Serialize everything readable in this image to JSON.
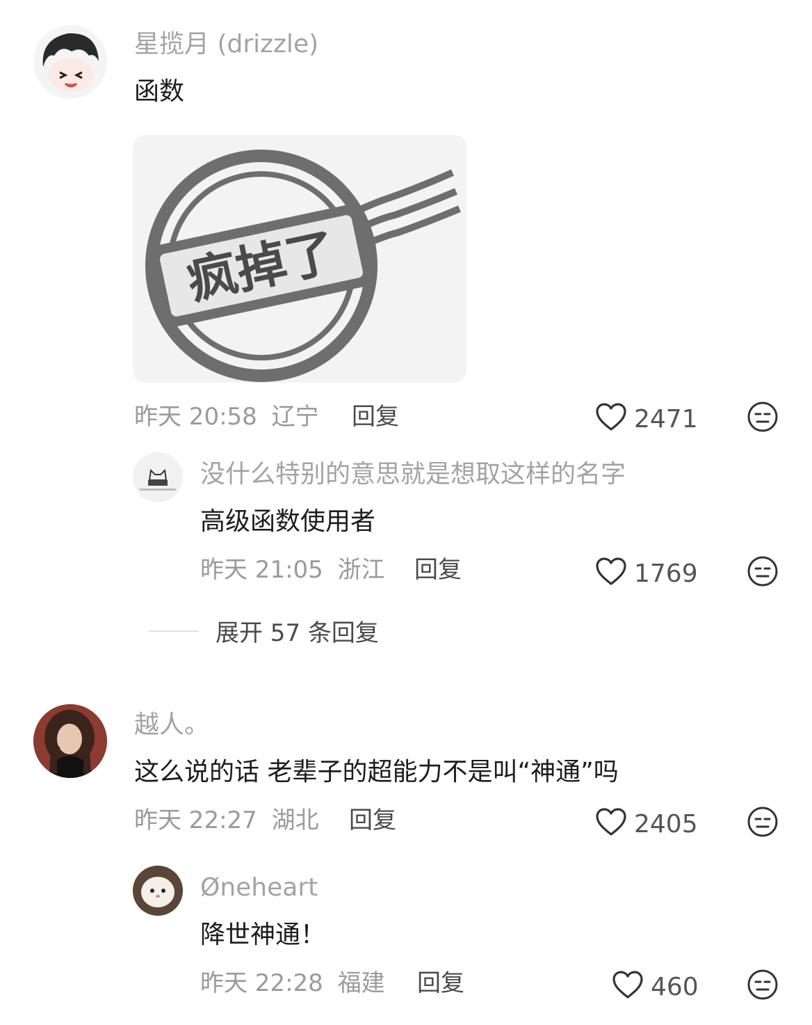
{
  "comments": [
    {
      "name": "星揽月 (drizzle)",
      "text": "函数",
      "sticker_text": "疯掉了",
      "time": "昨天 20:58",
      "location": "辽宁",
      "reply_label": "回复",
      "likes": "2471",
      "replies": [
        {
          "name": "没什么特别的意思就是想取这样的名字",
          "text": "高级函数使用者",
          "time": "昨天 21:05",
          "location": "浙江",
          "reply_label": "回复",
          "likes": "1769"
        }
      ],
      "expand_label": "展开 57 条回复"
    },
    {
      "name": "越人。",
      "text": "这么说的话 老辈子的超能力不是叫“神通”吗",
      "time": "昨天 22:27",
      "location": "湖北",
      "reply_label": "回复",
      "likes": "2405",
      "replies": [
        {
          "name": "Øneheart",
          "text": "降世神通！",
          "time": "昨天 22:28",
          "location": "福建",
          "reply_label": "回复",
          "likes": "460"
        }
      ]
    }
  ],
  "icons": {
    "like": "heart-outline-icon",
    "dislike": "meh-face-icon"
  }
}
